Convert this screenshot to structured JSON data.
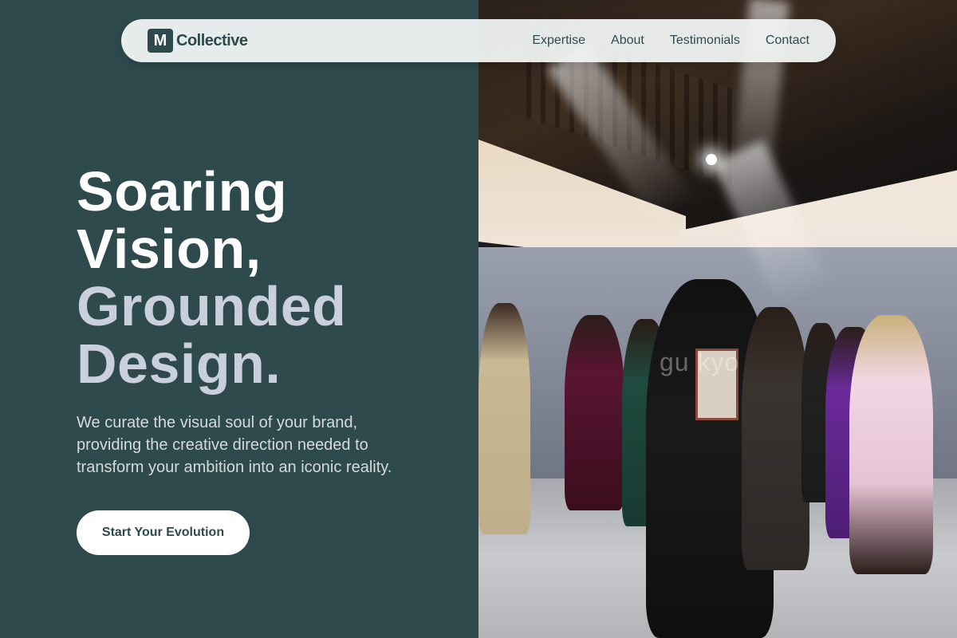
{
  "nav": {
    "logo_letter": "M",
    "brand": "Collective",
    "links": [
      "Expertise",
      "About",
      "Testimonials",
      "Contact"
    ]
  },
  "hero": {
    "headline_line1": "Soaring",
    "headline_line2": "Vision,",
    "headline_line3": "Grounded",
    "headline_line4": "Design.",
    "subtitle": "We curate the visual soul of your brand, providing the creative direction needed to transform your ambition into an iconic reality.",
    "cta_label": "Start Your Evolution"
  },
  "photo": {
    "watermark": "gu   kyo"
  },
  "colors": {
    "primary": "#2e4a4d",
    "nav_bg": "#f0f3f3",
    "headline_white": "#ffffff",
    "headline_muted": "#c9d0dc"
  }
}
